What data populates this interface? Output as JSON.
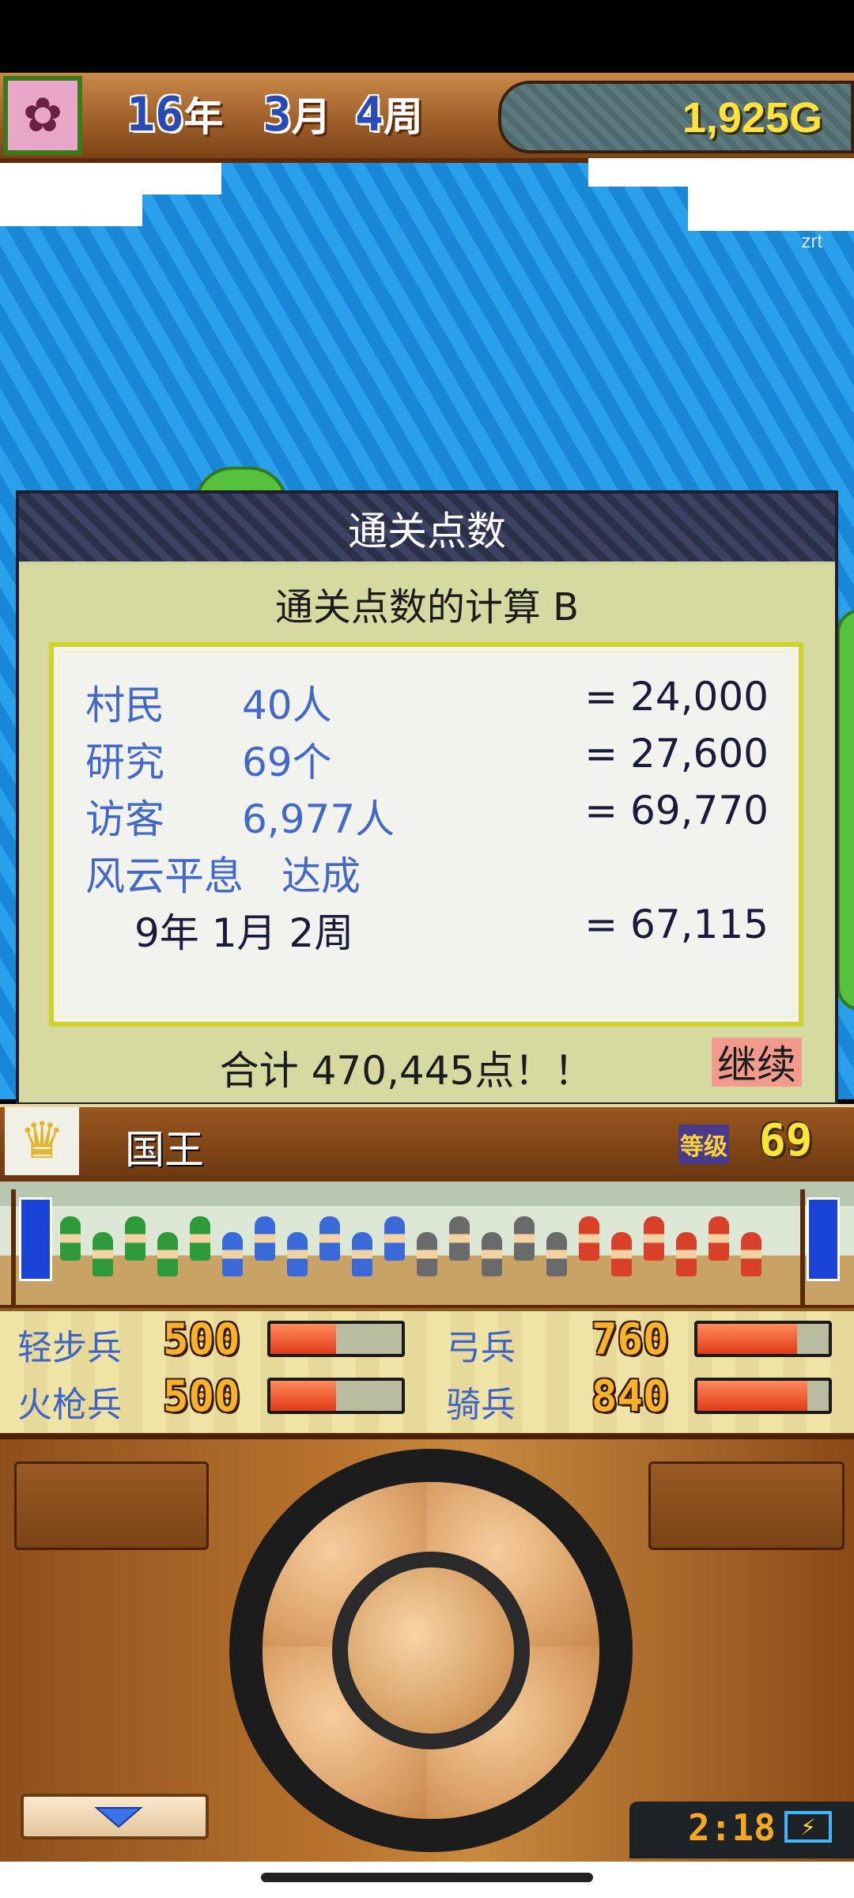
{
  "header": {
    "year_num": "16",
    "year_unit": "年",
    "month_num": "3",
    "month_unit": "月",
    "week_num": "4",
    "week_unit": "周",
    "gold": "1,925G",
    "watermark": "zrt"
  },
  "dialog": {
    "title": "通关点数",
    "subtitle": "通关点数的计算 B",
    "rows": [
      {
        "label": "村民",
        "value": "40人",
        "result": "= 24,000"
      },
      {
        "label": "研究",
        "value": "69个",
        "result": "= 27,600"
      },
      {
        "label": "访客",
        "value": "6,977人",
        "result": "= 69,770"
      }
    ],
    "achievement": {
      "label": "风云平息",
      "status": "达成",
      "date": "9年 1月 2周",
      "result": "= 67,115"
    },
    "total": "合计 470,445点！！",
    "continue_label": "继续"
  },
  "ruler": {
    "name": "国王",
    "level_label": "等级",
    "level": "69"
  },
  "troops": [
    {
      "name": "轻步兵",
      "count": "500",
      "ratio": 0.5
    },
    {
      "name": "弓兵",
      "count": "760",
      "ratio": 0.76
    },
    {
      "name": "火枪兵",
      "count": "500",
      "ratio": 0.5
    },
    {
      "name": "骑兵",
      "count": "840",
      "ratio": 0.84
    }
  ],
  "clock": "2:18",
  "icons": [
    "avatar-icon",
    "crown-icon",
    "dropdown-arrow-icon",
    "battery-icon"
  ],
  "colors": {
    "accent_blue": "#4268c9",
    "gold_text": "#ffe23a",
    "bar_fill": "#e13c1a",
    "continue_bg": "#f29b8d"
  }
}
